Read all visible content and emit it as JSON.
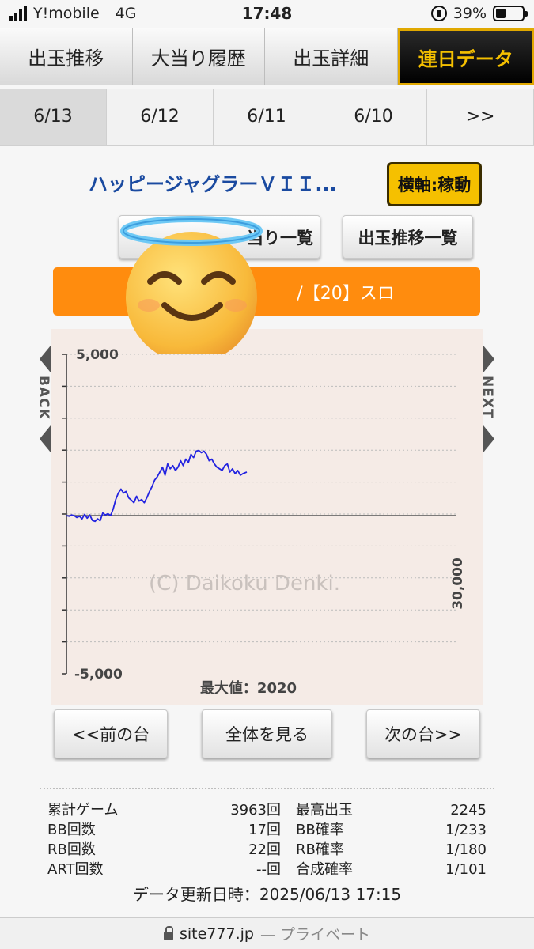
{
  "status_bar": {
    "carrier": "Y!mobile",
    "network": "4G",
    "time": "17:48",
    "battery": "39%",
    "battery_level": 0.39
  },
  "tabs": [
    {
      "label": "出玉推移",
      "active": false
    },
    {
      "label": "大当り履歴",
      "active": false
    },
    {
      "label": "出玉詳細",
      "active": false
    },
    {
      "label": "連日データ",
      "active": true
    }
  ],
  "dates": [
    {
      "label": "6/13",
      "active": true
    },
    {
      "label": "6/12",
      "active": false
    },
    {
      "label": "6/11",
      "active": false
    },
    {
      "label": "6/10",
      "active": false
    },
    {
      "label": ">>",
      "active": false
    }
  ],
  "machine_name": "ハッピージャグラーＶＩＩ...",
  "axis_toggle": "横軸:稼動",
  "buttons": {
    "jackpot_list": "当り一覧",
    "output_list": "出玉推移一覧",
    "prev": "<<前の台",
    "all": "全体を見る",
    "next": "次の台>>"
  },
  "banner": "/【20】スロ",
  "chart_nav": {
    "back": "BACK",
    "next": "NEXT"
  },
  "chart_data": {
    "type": "line",
    "y_ticks": [
      "5,000",
      "-5,000"
    ],
    "x_end_label": "30,000",
    "ylim": [
      -5000,
      5000
    ],
    "xlim": [
      0,
      30000
    ],
    "watermark": "(C) Daikoku Denki.",
    "max_label": "最大値：2020",
    "grid": true,
    "series": [
      {
        "color": "#2323e0",
        "x": [
          0,
          200,
          400,
          600,
          800,
          1000,
          1200,
          1400,
          1600,
          1800,
          2000,
          2200,
          2400,
          2600,
          2800,
          3000,
          3200,
          3400,
          3600,
          3800,
          4000,
          4200,
          4400,
          4600,
          4800,
          5000,
          5200,
          5400,
          5600,
          5800,
          6000,
          6200,
          6400,
          6600,
          6800,
          7000,
          7200,
          7400,
          7600,
          7800,
          8000,
          8200,
          8400,
          8600,
          8800,
          9000,
          9200,
          9400,
          9600,
          9800,
          10000,
          10200,
          10400,
          10600,
          10800,
          11000,
          11200,
          11400,
          11600,
          11800,
          12000,
          12200,
          12400,
          12600,
          12800,
          13000,
          13200,
          13400,
          13600,
          13900
        ],
        "y": [
          0,
          -20,
          20,
          0,
          -60,
          -20,
          -100,
          40,
          -80,
          20,
          -150,
          -180,
          -100,
          -160,
          80,
          20,
          60,
          0,
          200,
          500,
          700,
          820,
          700,
          750,
          550,
          480,
          400,
          600,
          450,
          500,
          400,
          560,
          750,
          900,
          1100,
          1200,
          1350,
          1500,
          1250,
          1600,
          1450,
          1550,
          1400,
          1500,
          1700,
          1550,
          1750,
          1650,
          1900,
          1800,
          2000,
          2020,
          1950,
          2000,
          1900,
          1700,
          1750,
          1600,
          1500,
          1450,
          1400,
          1550,
          1600,
          1350,
          1450,
          1300,
          1400,
          1250,
          1300,
          1350
        ]
      }
    ]
  },
  "stats": [
    {
      "k1": "累計ゲーム",
      "v1": "3963回",
      "k2": "最高出玉",
      "v2": "2245"
    },
    {
      "k1": "BB回数",
      "v1": "17回",
      "k2": "BB確率",
      "v2": "1/233"
    },
    {
      "k1": "RB回数",
      "v1": "22回",
      "k2": "RB確率",
      "v2": "1/180"
    },
    {
      "k1": "ART回数",
      "v1": "--回",
      "k2": "合成確率",
      "v2": "1/101"
    }
  ],
  "updated": "データ更新日時：2025/06/13 17:15",
  "url_bar": {
    "domain": "site777.jp",
    "privacy": "— プライベート"
  }
}
